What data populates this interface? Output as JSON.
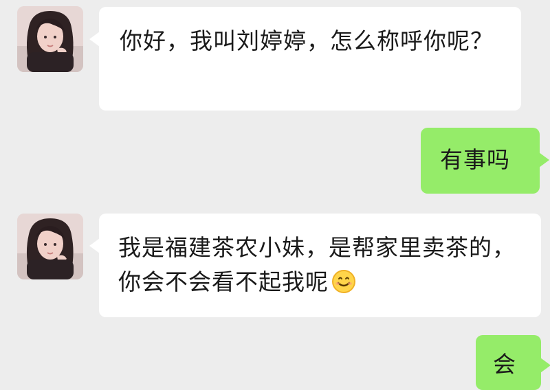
{
  "conversation": {
    "messages": [
      {
        "side": "left",
        "text": "你好，我叫刘婷婷，怎么称呼你呢？",
        "avatar_icon": "female-avatar-icon"
      },
      {
        "side": "right",
        "text": "有事吗"
      },
      {
        "side": "left",
        "text": "我是福建茶农小妹，是帮家里卖茶的，你会不会看不起我呢",
        "emoji": "smiling-face-emoji",
        "avatar_icon": "female-avatar-icon"
      },
      {
        "side": "right",
        "text": "会"
      }
    ]
  },
  "colors": {
    "background": "#ededed",
    "incoming_bubble": "#ffffff",
    "outgoing_bubble": "#95ec69",
    "text": "#1a1a1a"
  }
}
